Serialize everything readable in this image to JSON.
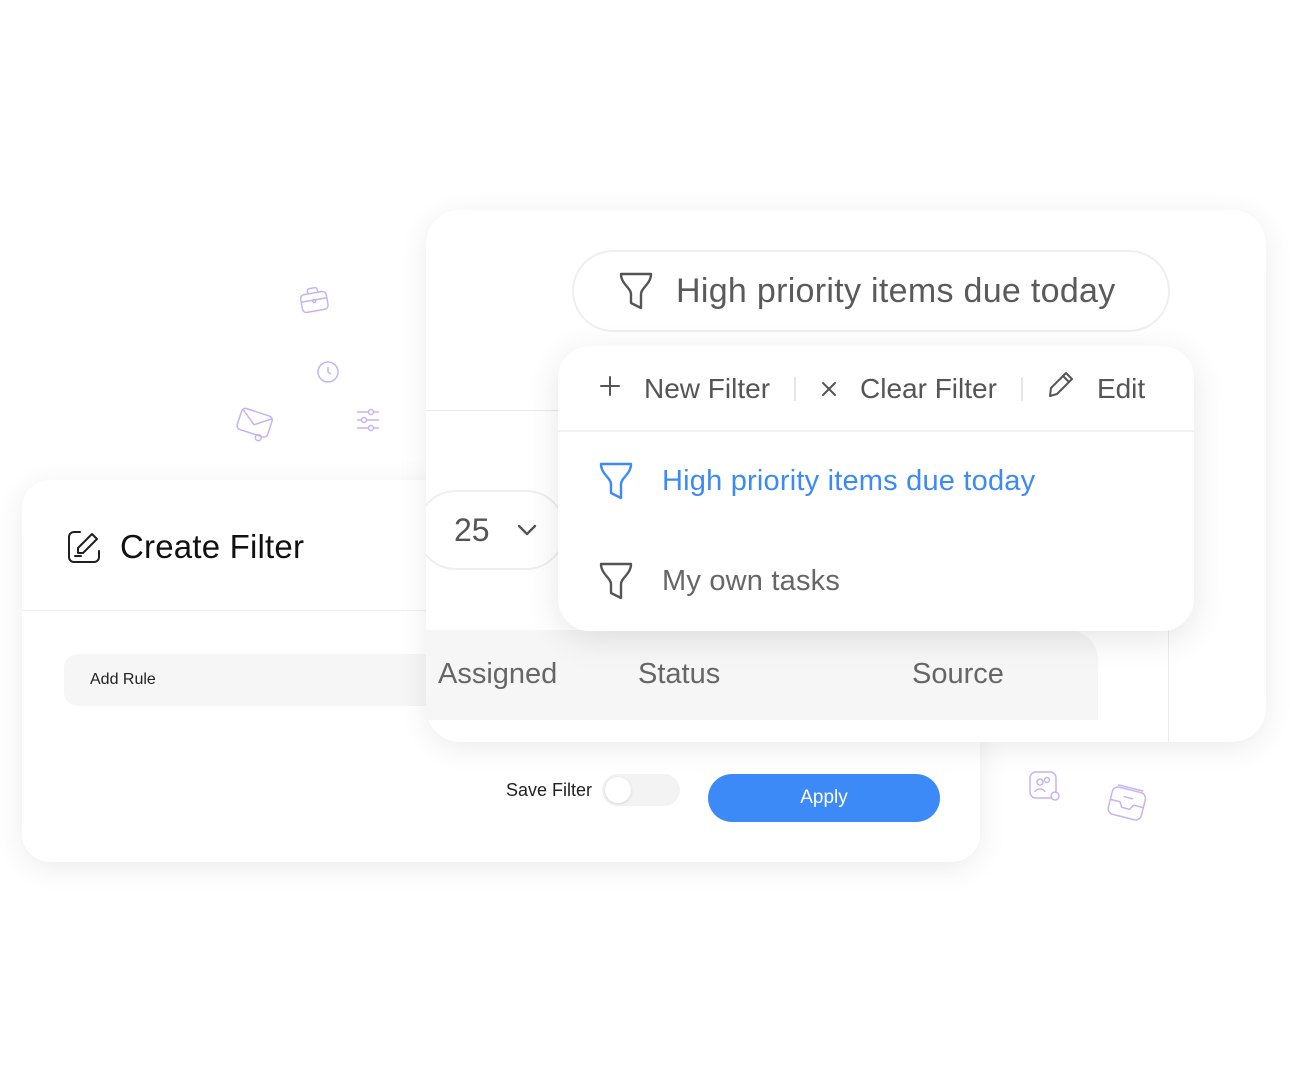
{
  "create_filter": {
    "title": "Create Filter",
    "add_rule_label": "Add Rule",
    "save_filter_label": "Save Filter",
    "save_filter_enabled": false,
    "apply_label": "Apply"
  },
  "table": {
    "active_filter": "High priority items due today",
    "page_size": "25",
    "columns": [
      "Assigned",
      "Status",
      "Source"
    ]
  },
  "dropdown": {
    "actions": {
      "new_filter": "New Filter",
      "clear_filter": "Clear Filter",
      "edit": "Edit"
    },
    "items": [
      {
        "label": "High priority items due today",
        "active": true
      },
      {
        "label": "My own tasks",
        "active": false
      }
    ]
  },
  "colors": {
    "accent": "#3b8af7",
    "decorative": "#c7b3f2"
  },
  "decorative_icons": [
    "briefcase-icon",
    "clock-icon",
    "envelope-icon",
    "sliders-icon",
    "contacts-icon",
    "inbox-icon"
  ]
}
